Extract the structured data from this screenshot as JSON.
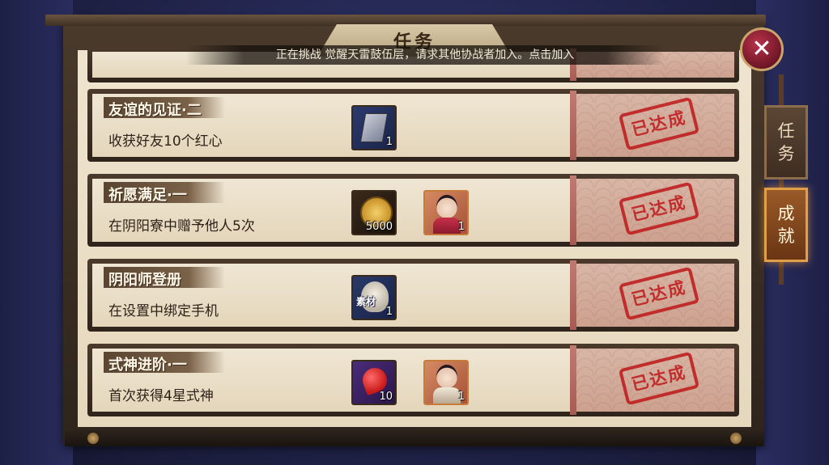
{
  "header": {
    "title": "任务",
    "notice": "正在挑战 觉醒天雷鼓伍层，请求其他协战者加入。点击加入"
  },
  "tabs": [
    {
      "label_1": "任",
      "label_2": "务",
      "active": false
    },
    {
      "label_1": "成",
      "label_2": "就",
      "active": true
    }
  ],
  "tasks": [
    {
      "title": "友谊的见证·二",
      "description": "收获好友10个红心",
      "rewards": [
        {
          "icon": "card-icon",
          "count": "1"
        }
      ],
      "status": "已达成"
    },
    {
      "title": "祈愿满足·一",
      "description": "在阴阳寮中赠予他人5次",
      "rewards": [
        {
          "icon": "coin-icon",
          "count": "5000"
        },
        {
          "icon": "shikigami-portrait-icon",
          "count": "1"
        }
      ],
      "status": "已达成"
    },
    {
      "title": "阴阳师登册",
      "description": "在设置中绑定手机",
      "rewards": [
        {
          "icon": "daruma-icon",
          "tag": "素材",
          "count": "1"
        }
      ],
      "status": "已达成"
    },
    {
      "title": "式神进阶·一",
      "description": "首次获得4星式神",
      "rewards": [
        {
          "icon": "bean-icon",
          "count": "10"
        },
        {
          "icon": "shikigami-portrait-icon",
          "count": "1"
        }
      ],
      "status": "已达成"
    }
  ],
  "colors": {
    "stamp": "#c02020",
    "active_tab": "#9a5a28",
    "paper": "#efe4cf"
  }
}
